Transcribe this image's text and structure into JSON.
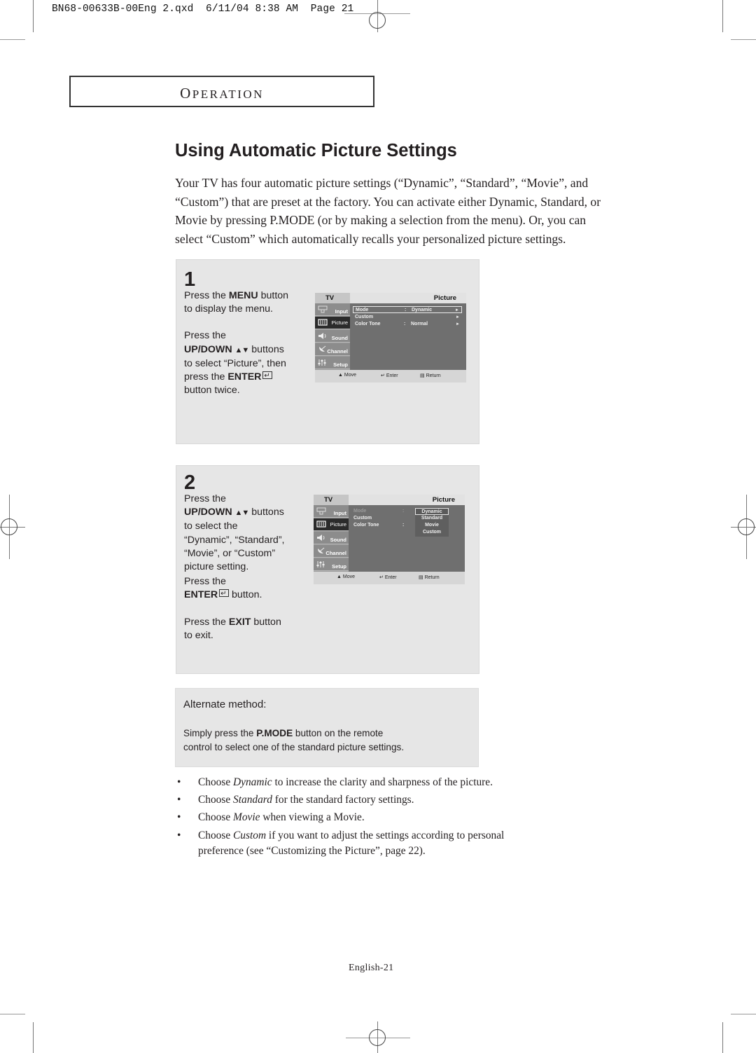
{
  "slug": {
    "filename": "BN68-00633B-00Eng 2.qxd",
    "date": "6/11/04",
    "time": "8:38 AM",
    "page_label": "Page 21"
  },
  "section": {
    "label_first": "O",
    "label_rest": "PERATION"
  },
  "title": "Using Automatic Picture Settings",
  "intro": {
    "lines": [
      "Your TV has four automatic picture settings (“Dynamic”, “Standard”, “Movie”,         and",
      "“Custom”) that are preset at the factory.  You can activate either Dynamic, Standard, or",
      "Movie by pressing P.MODE (or by making a selection from the menu). Or, you can",
      "select “Custom” which automatically recalls your personalized picture settings."
    ]
  },
  "steps": [
    {
      "number": "1",
      "text": {
        "press_the": "Press the",
        "menu": "MENU",
        "button": "button",
        "to_display": "to display the menu.",
        "press_the_2": "Press the",
        "updown": "UP/DOWN",
        "arrows": "▲▼",
        "buttons": "buttons",
        "to_select": "to select “Picture”, then",
        "press_the_3": "press the",
        "enter": "ENTER",
        "button_twice": "button twice."
      },
      "osd": {
        "tv_label": "TV",
        "header": "Picture",
        "tabs": [
          {
            "label": "Input",
            "icon": "input-icon",
            "active": false
          },
          {
            "label": "Picture",
            "icon": "picture-icon",
            "active": true
          },
          {
            "label": "Sound",
            "icon": "speaker-icon",
            "active": false
          },
          {
            "label": "Channel",
            "icon": "satellite-dish-icon",
            "active": false
          },
          {
            "label": "Setup",
            "icon": "sliders-icon",
            "active": false
          }
        ],
        "rows": [
          {
            "label": "Mode",
            "colon": ":",
            "value": "Dynamic",
            "arrow": "►",
            "selected": true
          },
          {
            "label": "Custom",
            "colon": "",
            "value": "",
            "arrow": "►",
            "selected": false
          },
          {
            "label": "Color Tone",
            "colon": ":",
            "value": "Normal",
            "arrow": "►",
            "selected": false
          }
        ],
        "footer": {
          "move": "Move",
          "enter": "Enter",
          "return": "Return"
        }
      }
    },
    {
      "number": "2",
      "text": {
        "press_the": "Press the",
        "updown": "UP/DOWN",
        "arrows": "▲▼",
        "buttons": "buttons",
        "line3": "to select the",
        "line4": "“Dynamic”, “Standard”,",
        "line5": "“Movie”, or “Custom”",
        "line6": "picture setting.",
        "press_the_2": "Press the",
        "enter": "ENTER",
        "button": "button.",
        "press_the_3": "Press the",
        "exit": "EXIT",
        "button_2": "button",
        "to_exit": "to exit."
      },
      "osd": {
        "tv_label": "TV",
        "header": "Picture",
        "tabs": [
          {
            "label": "Input",
            "icon": "input-icon",
            "active": false
          },
          {
            "label": "Picture",
            "icon": "picture-icon",
            "active": true
          },
          {
            "label": "Sound",
            "icon": "speaker-icon",
            "active": false
          },
          {
            "label": "Channel",
            "icon": "satellite-dish-icon",
            "active": false
          },
          {
            "label": "Setup",
            "icon": "sliders-icon",
            "active": false
          }
        ],
        "rows": [
          {
            "label": "Mode",
            "colon": ":"
          },
          {
            "label": "Custom",
            "colon": ""
          },
          {
            "label": "Color Tone",
            "colon": ":"
          }
        ],
        "dropdown": {
          "options": [
            "Dynamic",
            "Standard",
            "Movie",
            "Custom"
          ],
          "selected": "Dynamic"
        },
        "footer": {
          "move": "Move",
          "enter": "Enter",
          "return": "Return"
        }
      }
    }
  ],
  "alternate": {
    "title": "Alternate method:",
    "line1_pre": "Simply press the ",
    "line1_bold": "P.MODE",
    "line1_post": " button on the remote",
    "line2": "control to select one of the standard picture settings."
  },
  "bullets": [
    {
      "pre": "Choose ",
      "em": "Dynamic",
      "post": " to increase the clarity and sharpness of the picture."
    },
    {
      "pre": "Choose ",
      "em": "Standard",
      "post": " for the standard factory settings."
    },
    {
      "pre": "Choose ",
      "em": "Movie",
      "post": " when viewing a Movie."
    },
    {
      "pre": "Choose ",
      "em": "Custom",
      "post": " if you want to adjust the settings according to personal",
      "line2": "preference (see “Customizing the Picture”, page 22)."
    }
  ],
  "bullet_char": "•",
  "footer": {
    "page": "English-21"
  }
}
